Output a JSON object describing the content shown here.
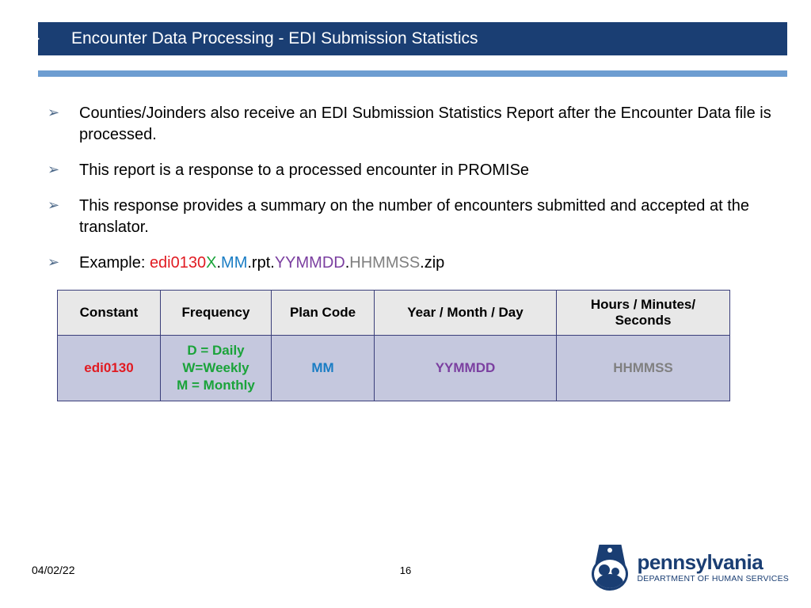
{
  "header": {
    "title": "Encounter Data Processing - EDI Submission Statistics"
  },
  "bullets": [
    "Counties/Joinders also receive an EDI Submission Statistics Report after the Encounter Data file is processed.",
    "This report is a response to a processed encounter in PROMISe",
    "This response provides a summary on the number of encounters submitted and accepted at the translator."
  ],
  "example": {
    "prefix": "Example: ",
    "parts": {
      "p1": "edi0130",
      "p2": "X",
      "dot1": ".",
      "p3": "MM",
      "rpt": ".rpt.",
      "p4": "YYMMDD",
      "dot2": ".",
      "p5": "HHMMSS",
      "zip": ".zip"
    }
  },
  "table": {
    "headers": [
      "Constant",
      "Frequency",
      "Plan Code",
      "Year / Month / Day",
      "Hours / Minutes/ Seconds"
    ],
    "row": {
      "constant": "edi0130",
      "freq_l1": "D = Daily",
      "freq_l2": "W=Weekly",
      "freq_l3": "M = Monthly",
      "plan": "MM",
      "ymd": "YYMMDD",
      "hms": "HHMMSS"
    }
  },
  "footer": {
    "date": "04/02/22",
    "page": "16"
  },
  "logo": {
    "state": "pennsylvania",
    "dept": "DEPARTMENT OF HUMAN SERVICES"
  }
}
